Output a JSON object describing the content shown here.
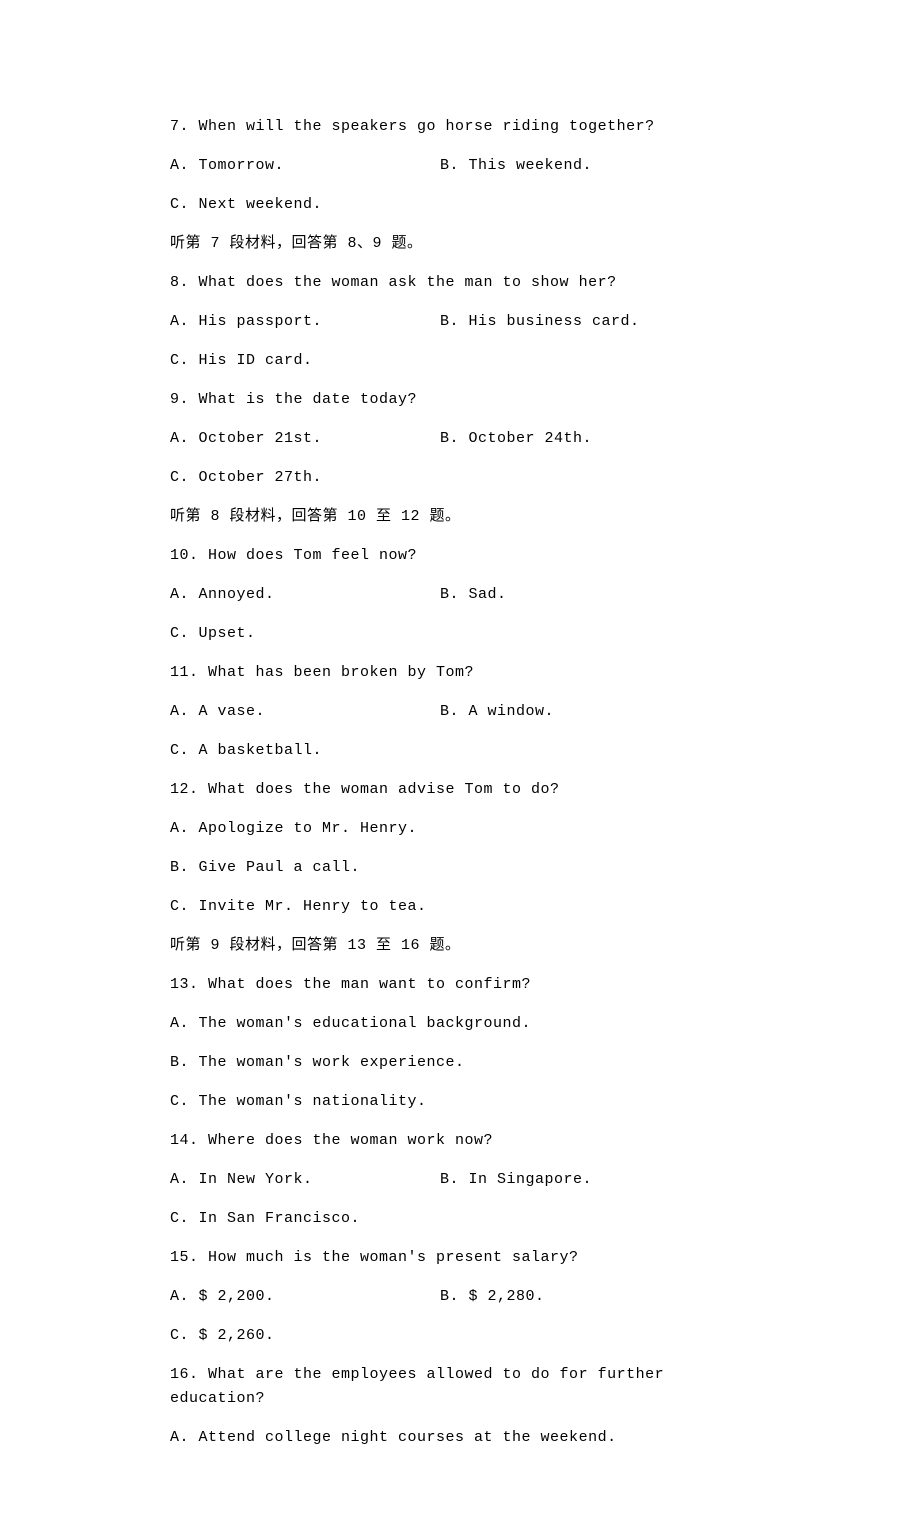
{
  "q7": {
    "text": "7. When will the speakers go horse riding together?",
    "a": "A. Tomorrow.",
    "b": "B. This weekend.",
    "c": "C. Next weekend."
  },
  "section7": "听第 7 段材料，回答第 8、9 题。",
  "q8": {
    "text": "8. What does the woman ask the man to show her?",
    "a": "A. His passport.",
    "b": "B. His business card.",
    "c": "C. His ID card."
  },
  "q9": {
    "text": "9. What is the date today?",
    "a": "A. October 21st.",
    "b": "B. October 24th.",
    "c": "C. October 27th."
  },
  "section8": "听第 8 段材料，回答第 10 至 12 题。",
  "q10": {
    "text": "10. How does Tom feel now?",
    "a": "A. Annoyed.",
    "b": "B. Sad.",
    "c": "C. Upset."
  },
  "q11": {
    "text": "11. What has been broken by Tom?",
    "a": "A. A vase.",
    "b": "B. A window.",
    "c": "C. A basketball."
  },
  "q12": {
    "text": "12. What does the woman advise Tom to do?",
    "a": "A. Apologize to Mr. Henry.",
    "b": "B. Give Paul a call.",
    "c": "C. Invite Mr. Henry to tea."
  },
  "section9": "听第 9 段材料，回答第 13 至 16 题。",
  "q13": {
    "text": "13. What does the man want to confirm?",
    "a": "A. The woman's educational background.",
    "b": "B. The woman's work experience.",
    "c": "C. The woman's nationality."
  },
  "q14": {
    "text": "14. Where does the woman work now?",
    "a": "A. In New York.",
    "b": "B. In Singapore.",
    "c": "C. In San Francisco."
  },
  "q15": {
    "text": "15. How much is the woman's present salary?",
    "a": "A. $ 2,200.",
    "b": "B. $ 2,280.",
    "c": "C. $ 2,260."
  },
  "q16": {
    "text": "16. What are the employees allowed to do for further education?",
    "a": "A. Attend college night courses at the weekend."
  }
}
